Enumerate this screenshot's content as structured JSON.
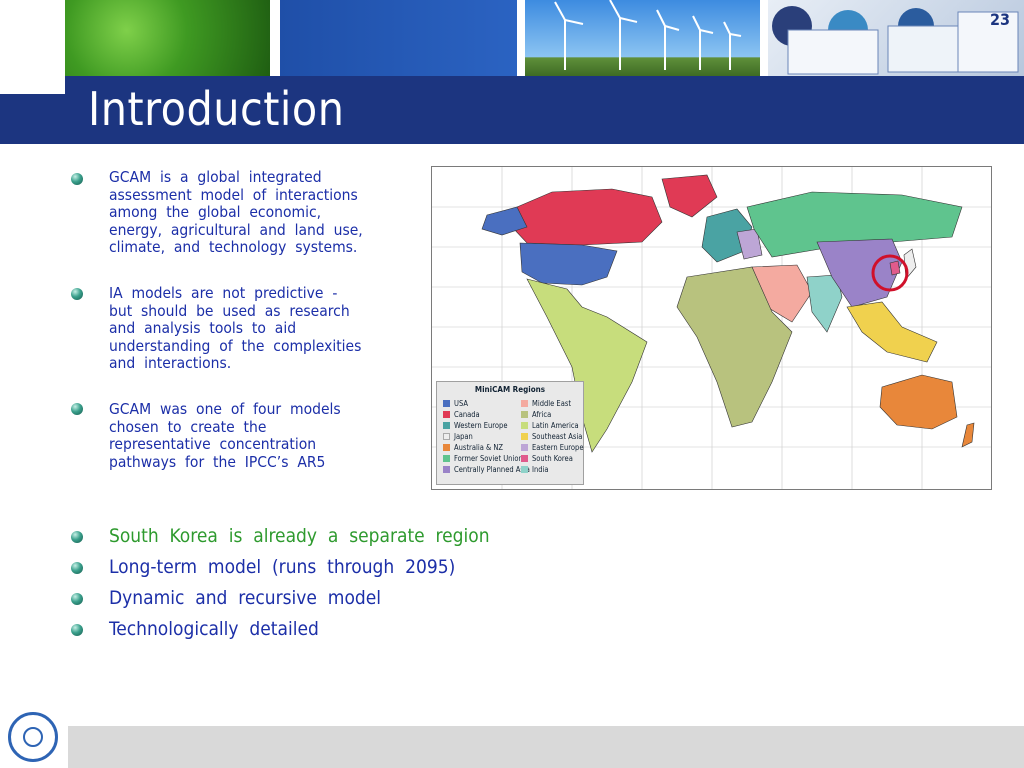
{
  "header": {
    "title": "Introduction",
    "slide_number": "23"
  },
  "bullets_top": [
    {
      "text": "GCAM  is  a  global  integrated\nassessment  model  of  interactions\namong  the  global  economic,\nenergy,  agricultural  and  land  use,\nclimate,  and  technology  systems."
    },
    {
      "text": "IA  models  are  not  predictive  -\nbut  should  be  used  as  research\nand  analysis  tools  to  aid\nunderstanding  of  the  complexities\nand  interactions."
    },
    {
      "text": "GCAM  was  one  of  four  models\nchosen  to  create  the\nrepresentative  concentration\npathways  for  the  IPCC’s  AR5"
    }
  ],
  "bullets_bottom": [
    {
      "text": "South  Korea  is  already  a  separate  region",
      "highlight": true
    },
    {
      "text": "Long-term  model  (runs  through  2095)",
      "highlight": false
    },
    {
      "text": "Dynamic  and  recursive  model",
      "highlight": false
    },
    {
      "text": "Technologically  detailed",
      "highlight": false
    }
  ],
  "map": {
    "legend_title": "MiniCAM Regions",
    "legend_left": [
      {
        "label": "USA",
        "color": "#4a6fc0"
      },
      {
        "label": "Canada",
        "color": "#e03a55"
      },
      {
        "label": "Western Europe",
        "color": "#4aa3a3"
      },
      {
        "label": "Japan",
        "color": "#eeeeee"
      },
      {
        "label": "Australia & NZ",
        "color": "#e8873a"
      },
      {
        "label": "Former Soviet Union",
        "color": "#5fc48e"
      },
      {
        "label": "Centrally Planned Asia",
        "color": "#9a83c8"
      }
    ],
    "legend_right": [
      {
        "label": "Middle East",
        "color": "#f4aaa0"
      },
      {
        "label": "Africa",
        "color": "#b8c27e"
      },
      {
        "label": "Latin America",
        "color": "#c7dd7c"
      },
      {
        "label": "Southeast Asia",
        "color": "#f0d14e"
      },
      {
        "label": "Eastern Europe",
        "color": "#bda6d6"
      },
      {
        "label": "South Korea",
        "color": "#e05b8c"
      },
      {
        "label": "India",
        "color": "#8fd2c9"
      }
    ]
  }
}
